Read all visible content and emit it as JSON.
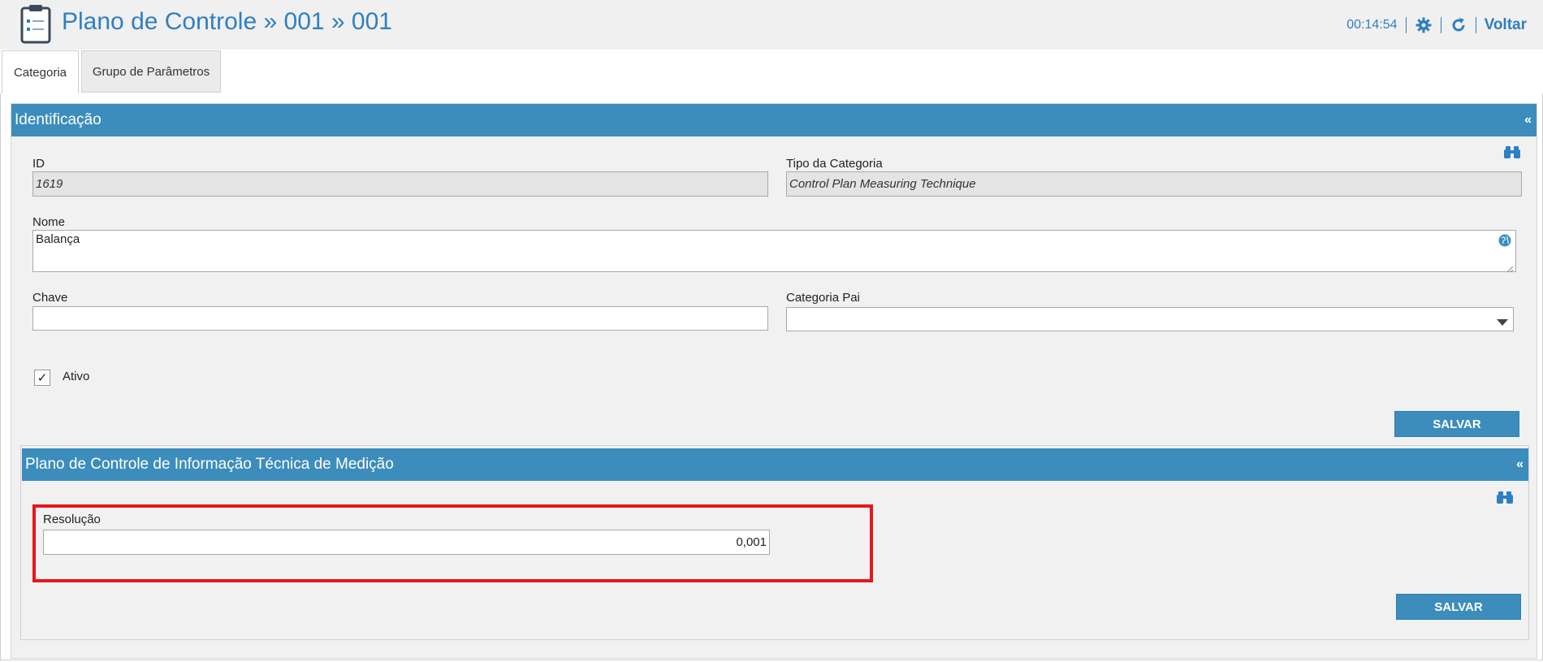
{
  "header": {
    "title": "Plano de Controle » 001 » 001",
    "timer": "00:14:54",
    "back_label": "Voltar",
    "accent_color": "#2f7fc1"
  },
  "tabs": [
    {
      "label": "Categoria",
      "active": true
    },
    {
      "label": "Grupo de Parâmetros",
      "active": false
    }
  ],
  "identificacao": {
    "title": "Identificação",
    "collapse_symbol": "«",
    "id_label": "ID",
    "id_value": "1619",
    "tipo_label": "Tipo da Categoria",
    "tipo_value": "Control Plan Measuring Technique",
    "nome_label": "Nome",
    "nome_value": "Balança",
    "chave_label": "Chave",
    "chave_value": "",
    "categoria_pai_label": "Categoria Pai",
    "categoria_pai_value": "",
    "ativo_label": "Ativo",
    "ativo_checked": "✓",
    "save_label": "SALVAR"
  },
  "medicao": {
    "title": "Plano de Controle de Informação Técnica de Medição",
    "collapse_symbol": "«",
    "resolucao_label": "Resolução",
    "resolucao_value": "0,001",
    "save_label": "SALVAR"
  },
  "colors": {
    "section_header": "#3c8dbc",
    "highlight_border": "#e8161b"
  },
  "icons": [
    "clipboard-icon",
    "gear-icon",
    "refresh-icon",
    "binoculars-icon",
    "globe-icon",
    "chevron-down-icon"
  ]
}
